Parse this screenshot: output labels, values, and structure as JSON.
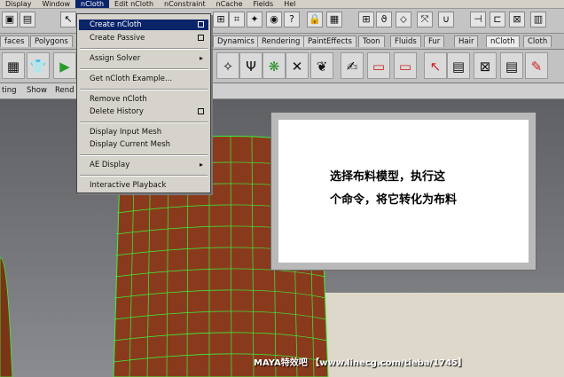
{
  "menubar": {
    "items": [
      {
        "label": "Display",
        "active": false
      },
      {
        "label": "Window",
        "active": false
      },
      {
        "label": "nCloth",
        "active": true
      },
      {
        "label": "Edit nCloth",
        "active": false
      },
      {
        "label": "nConstraint",
        "active": false
      },
      {
        "label": "nCache",
        "active": false
      },
      {
        "label": "Fields",
        "active": false
      },
      {
        "label": "Hel",
        "active": false
      }
    ]
  },
  "shelf_tabs": [
    {
      "label": "faces",
      "active": false
    },
    {
      "label": "Polygons",
      "active": false
    },
    {
      "label": "Dynamics",
      "active": false
    },
    {
      "label": "Rendering",
      "active": false
    },
    {
      "label": "PaintEffects",
      "active": false
    },
    {
      "label": "Toon",
      "active": false
    },
    {
      "label": "Fluids",
      "active": false
    },
    {
      "label": "Fur",
      "active": false
    },
    {
      "label": "Hair",
      "active": false
    },
    {
      "label": "nCloth",
      "active": true
    },
    {
      "label": "Cloth",
      "active": false
    }
  ],
  "panel_menu": [
    "ting",
    "Show",
    "Rend"
  ],
  "dropdown": {
    "items": [
      {
        "label": "Create nCloth",
        "selected": true,
        "option_box": true
      },
      {
        "label": "Create Passive",
        "selected": false,
        "option_box": true
      },
      {
        "label": "Assign Solver",
        "selected": false,
        "submenu": true
      },
      {
        "label": "Get nCloth Example...",
        "selected": false
      },
      {
        "label": "Remove nCloth",
        "selected": false
      },
      {
        "label": "Delete History",
        "selected": false,
        "option_box": true
      },
      {
        "label": "Display Input Mesh",
        "selected": false
      },
      {
        "label": "Display Current Mesh",
        "selected": false
      },
      {
        "label": "AE Display",
        "selected": false,
        "submenu": true
      },
      {
        "label": "Interactive Playback",
        "selected": false
      }
    ]
  },
  "callout": {
    "line1": "选择布料模型，执行这",
    "line2": "个命令，将它转化为布料"
  },
  "watermark": {
    "text": "MAYA特效吧 【www.linecg.com/tieba/1745】"
  },
  "colors": {
    "menu_highlight": "#0a246a",
    "mesh_fill": "#8a3a1c",
    "mesh_wire": "#3cf03c",
    "viewport_bg": "#6c6e72"
  }
}
